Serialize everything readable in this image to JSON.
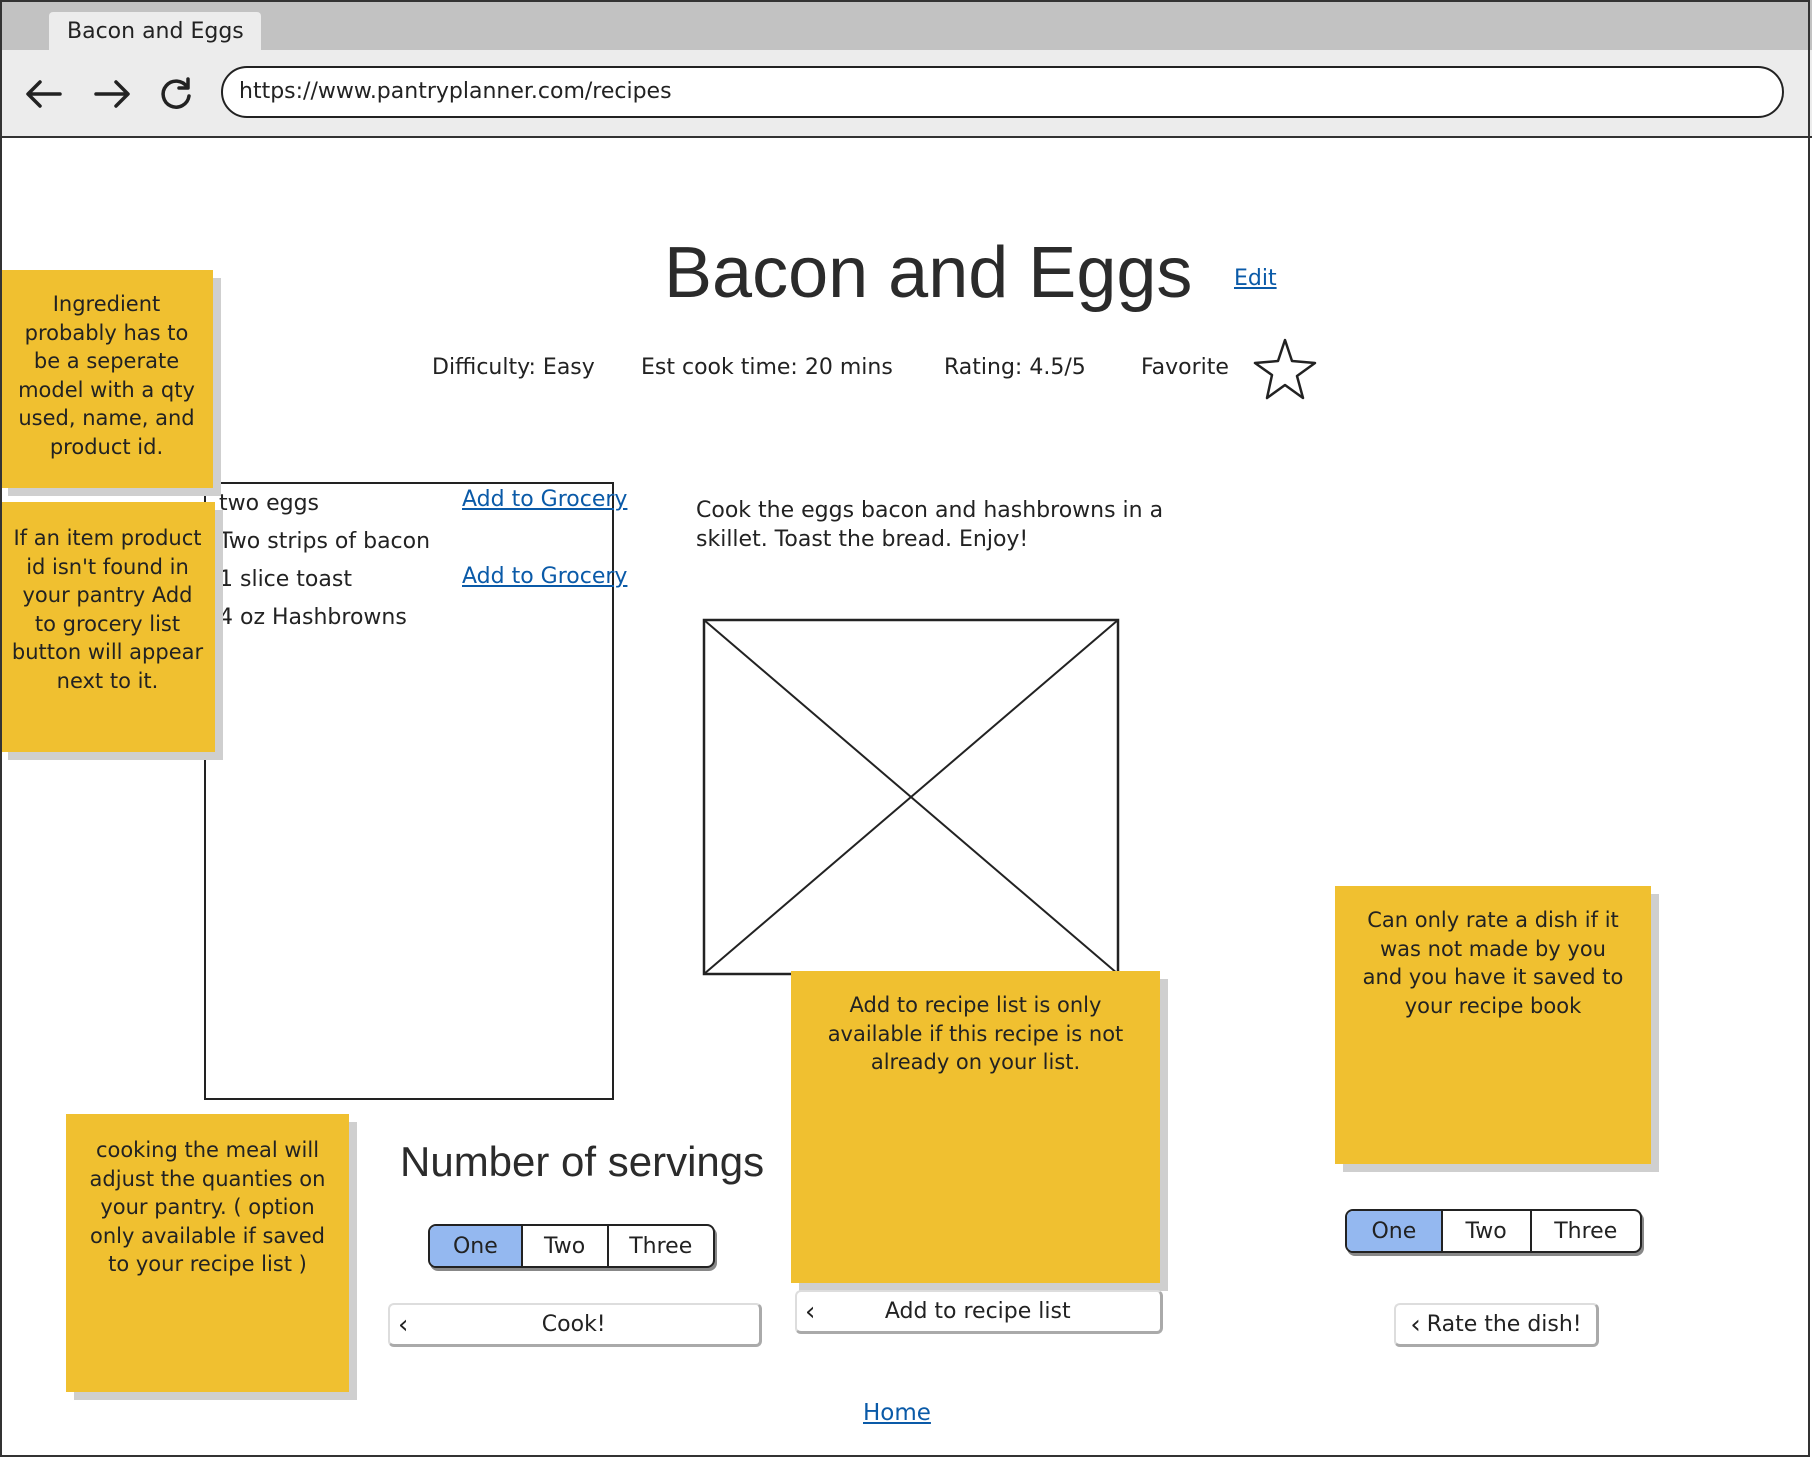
{
  "browser": {
    "tab_title": "Bacon and Eggs",
    "url": "https://www.pantryplanner.com/recipes"
  },
  "recipe": {
    "title": "Bacon and Eggs",
    "edit_label": "Edit",
    "difficulty": "Difficulty: Easy",
    "cook_time": "Est cook time: 20 mins",
    "rating": "Rating: 4.5/5",
    "favorite_label": "Favorite",
    "instructions": "Cook the eggs bacon and hashbrowns in a skillet. Toast the bread. Enjoy!"
  },
  "ingredients": [
    {
      "name": "two eggs",
      "grocery_label": "Add to Grocery"
    },
    {
      "name": "Two strips of bacon",
      "grocery_label": ""
    },
    {
      "name": "1 slice toast",
      "grocery_label": "Add to Grocery"
    },
    {
      "name": "4 oz Hashbrowns",
      "grocery_label": ""
    }
  ],
  "notes": {
    "ingredient_model": "Ingredient probably has to be a seperate model with a qty used, name, and product id.",
    "grocery_button": "If an item product id isn't found in your pantry Add to grocery list button will appear next to it.",
    "cooking": "cooking the meal will adjust the quanties on your pantry. ( option only available if saved to your recipe list )",
    "recipe_list": "Add to recipe list is only available if this recipe is not already on your list.",
    "rating": "Can only rate a dish if it was not made by you and you have it saved to your recipe book"
  },
  "servings": {
    "title": "Number of servings",
    "options": [
      "One",
      "Two",
      "Three"
    ],
    "selected": "One"
  },
  "rating_picker": {
    "options": [
      "One",
      "Two",
      "Three"
    ],
    "selected": "One"
  },
  "buttons": {
    "cook": "Cook!",
    "add_to_recipe_list": "Add to recipe list",
    "rate": "Rate the dish!"
  },
  "footer": {
    "home_label": "Home"
  },
  "colors": {
    "sticky_note": "#f0c030",
    "selected_option": "#94b8f0",
    "link": "#0a5aa8"
  }
}
